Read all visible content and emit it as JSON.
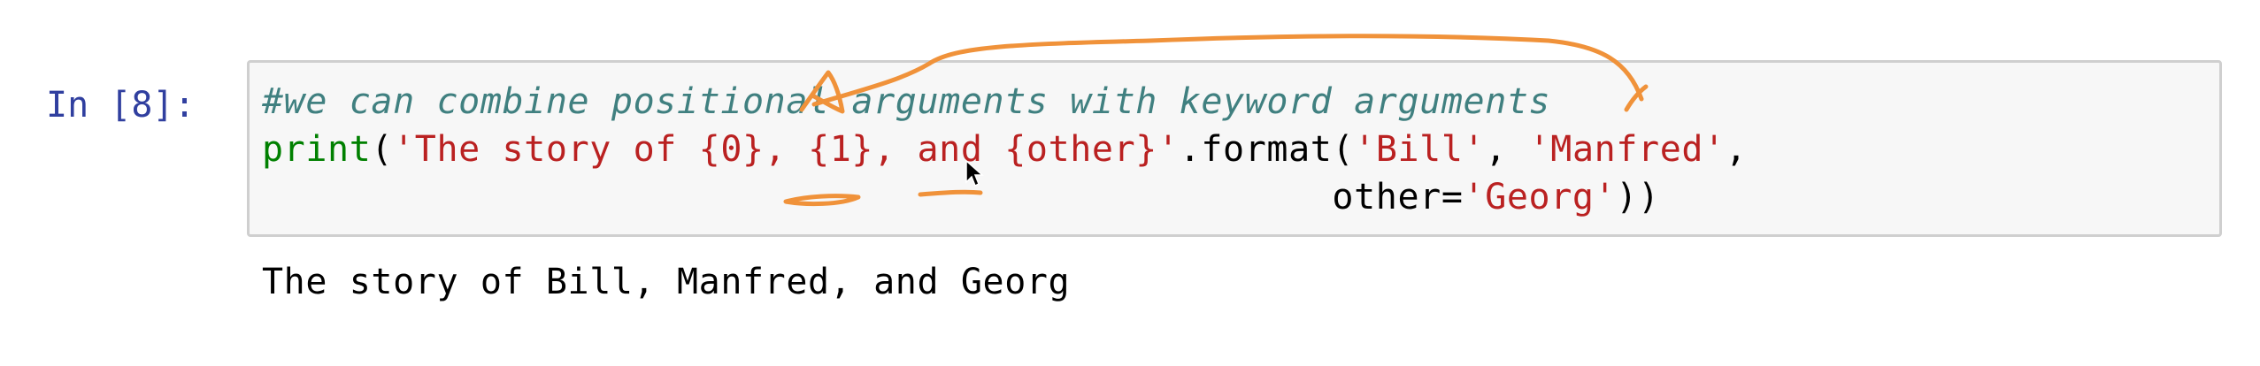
{
  "notebook": {
    "prompt": "In [8]:",
    "code_lines": [
      [
        {
          "text": "#we can combine positional arguments with keyword arguments",
          "kind": "comment"
        }
      ],
      [
        {
          "text": "print",
          "kind": "builtin"
        },
        {
          "text": "(",
          "kind": "op"
        },
        {
          "text": "'The story of {0}, {1}, and {other}'",
          "kind": "string"
        },
        {
          "text": ".format(",
          "kind": "op"
        },
        {
          "text": "'Bill'",
          "kind": "string"
        },
        {
          "text": ", ",
          "kind": "op"
        },
        {
          "text": "'Manfred'",
          "kind": "string"
        },
        {
          "text": ",",
          "kind": "op"
        }
      ],
      [
        {
          "text": "                                                 other=",
          "kind": "op"
        },
        {
          "text": "'Georg'",
          "kind": "string"
        },
        {
          "text": "))",
          "kind": "op"
        }
      ]
    ],
    "output": "The story of Bill, Manfred, and Georg"
  },
  "annotation": {
    "ink_color": "#f0923a",
    "cursor_icon": "arrow-cursor-icon"
  }
}
